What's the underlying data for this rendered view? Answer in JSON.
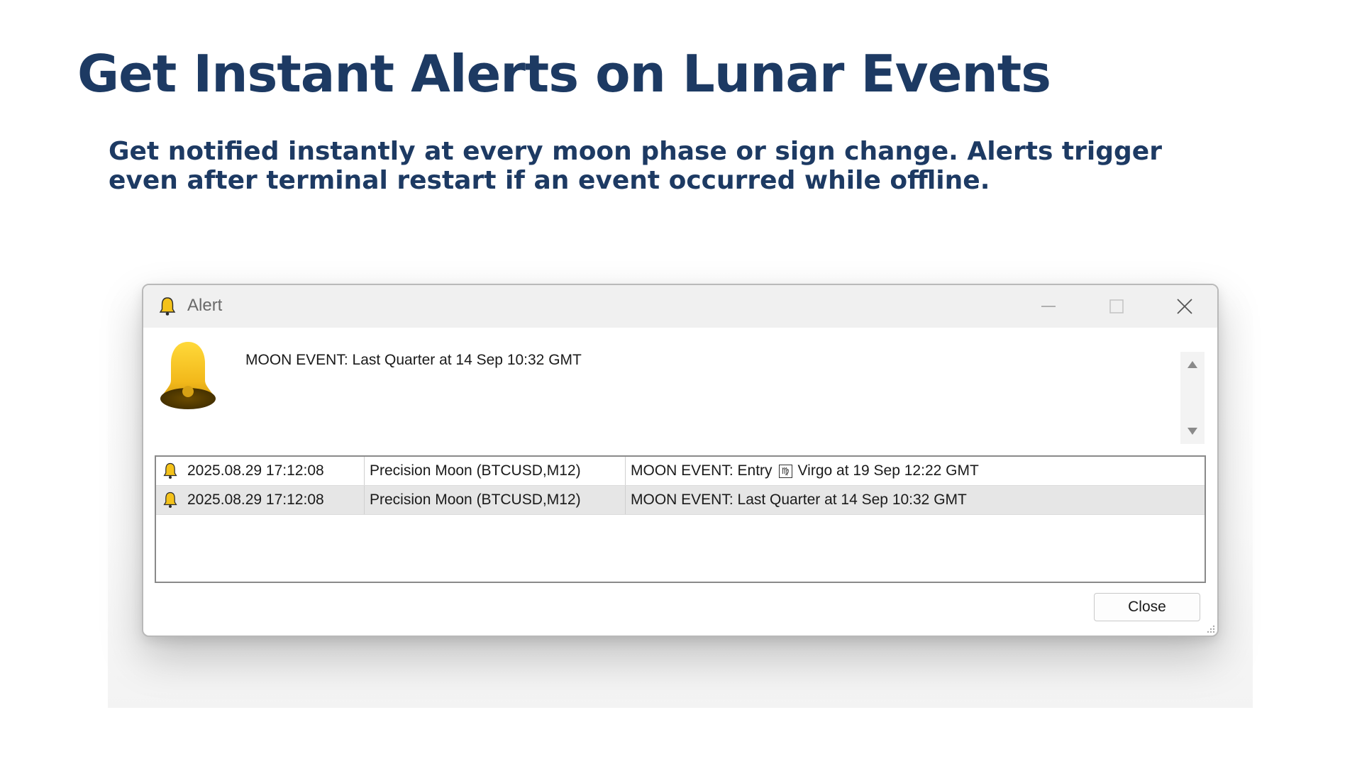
{
  "slide": {
    "headline": "Get Instant Alerts on Lunar Events",
    "subline": "Get notified instantly at every moon phase or sign change. Alerts trigger even after terminal restart if an event occurred while offline."
  },
  "window": {
    "title": "Alert",
    "title_icon": "bell-icon",
    "controls": {
      "minimize_icon": "minimize-icon",
      "maximize_icon": "maximize-icon",
      "close_icon": "close-icon"
    }
  },
  "message": {
    "icon": "bell-icon",
    "text": "MOON EVENT: Last Quarter at 14 Sep 10:32 GMT"
  },
  "alerts": [
    {
      "time": "2025.08.29 17:12:08",
      "source": "Precision Moon (BTCUSD,M12)",
      "message_prefix": "MOON EVENT: Entry",
      "zodiac_symbol": "♍",
      "message_suffix": "Virgo at 19 Sep 12:22 GMT"
    },
    {
      "time": "2025.08.29 17:12:08",
      "source": "Precision Moon (BTCUSD,M12)",
      "message": "MOON EVENT: Last Quarter at 14 Sep 10:32 GMT"
    }
  ],
  "footer": {
    "close_label": "Close"
  },
  "colors": {
    "headline": "#1d3a63",
    "bell_gold": "#f4c21a",
    "selected_row": "#e6e6e6"
  }
}
